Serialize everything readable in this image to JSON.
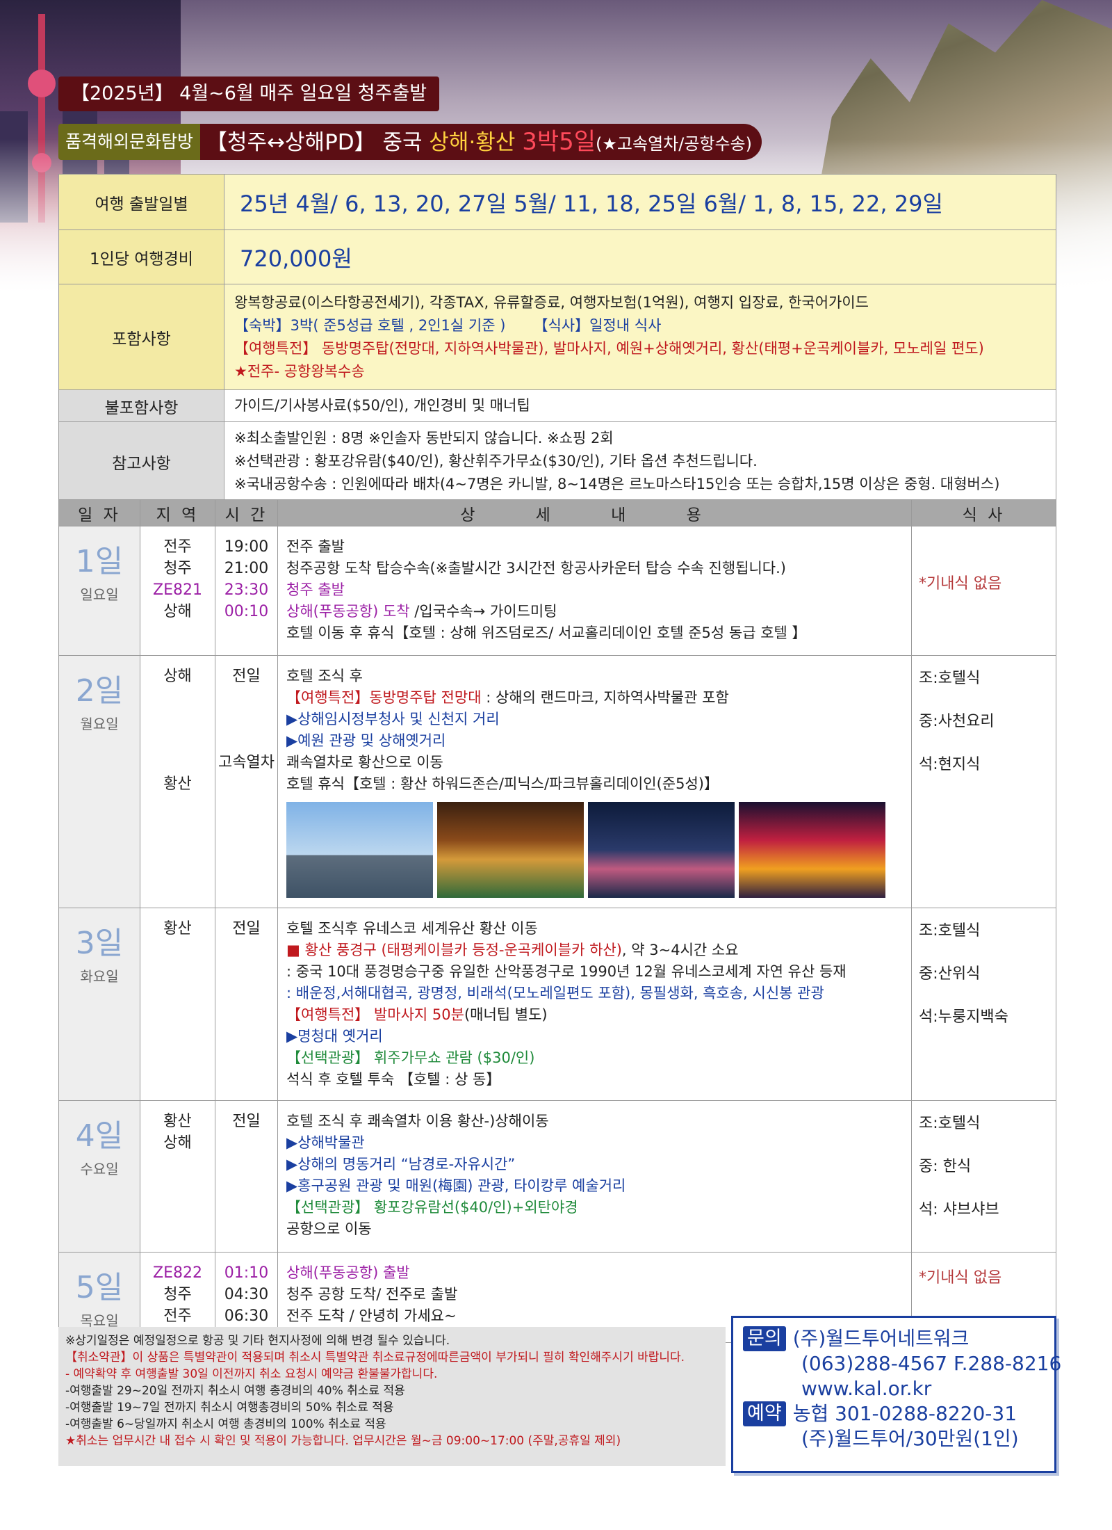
{
  "header": {
    "banner_top": "【2025년】 4월~6월 매주 일요일 청주출발",
    "tag": "품격해외문화탐방",
    "title_route": "【청주↔상해PD】",
    "title_country": "중국",
    "title_dest": "상해·황산",
    "title_days": "3박5일",
    "title_extra": "(★고속열차/공항수송)"
  },
  "info": {
    "departure_label": "여행 출발일별",
    "departure_value": "25년 4월/ 6, 13, 20, 27일 5월/ 11, 18, 25일 6월/ 1, 8, 15, 22, 29일",
    "price_label": "1인당 여행경비",
    "price_value": "720,000원",
    "included_label": "포함사항",
    "included_line1": "왕복항공료(이스타항공전세기), 각종TAX, 유류할증료, 여행자보험(1억원), 여행지 입장료, 한국어가이드",
    "included_line2a": "【숙박】3박( 준5성급 호텔 , 2인1실 기준 )",
    "included_line2b": "【식사】일정내 식사",
    "included_line3": "【여행특전】 동방명주탑(전망대, 지하역사박물관), 발마사지, 예원+상해옛거리, 황산(태평+운곡케이블카, 모노레일 편도)",
    "included_line4": "★전주- 공항왕복수송",
    "excluded_label": "불포함사항",
    "excluded_value": "가이드/기사봉사료($50/인), 개인경비 및 매너팁",
    "notes_label": "참고사항",
    "notes_line1": "※최소출발인원 : 8명 ※인솔자 동반되지 않습니다. ※쇼핑 2회",
    "notes_line2": "※선택관광 : 황포강유람($40/인), 황산휘주가무쇼($30/인), 기타 옵션 추천드립니다.",
    "notes_line3": "※국내공항수송 : 인원에따라 배차(4~7명은 카니발, 8~14명은 르노마스타15인승 또는 승합차,15명 이상은 중형. 대형버스)"
  },
  "itinerary": {
    "headers": [
      "일 자",
      "지 역",
      "시 간",
      "상 세 내 용",
      "식 사"
    ],
    "day1": {
      "num": "1일",
      "weekday": "일요일",
      "r1": "전주",
      "r2": "청주",
      "r3": "ZE821",
      "r4": "상해",
      "t1": "19:00",
      "t2": "21:00",
      "t3": "23:30",
      "t4": "00:10",
      "d1": "전주 출발",
      "d2": "청주공항 도착 탑승수속(※출발시간 3시간전 항공사카운터 탑승 수속 진행됩니다.)",
      "d3": "청주 출발",
      "d4a": "상해(푸동공항) 도착",
      "d4b": " /입국수속→ 가이드미팅",
      "d5": "호텔 이동 후 휴식【호텔 : 상해 위즈덤로즈/ 서교홀리데이인 호텔 준5성 동급 호텔 】",
      "meal": "*기내식 없음"
    },
    "day2": {
      "num": "2일",
      "weekday": "월요일",
      "r1": "상해",
      "r2": "황산",
      "t1": "전일",
      "t2": "고속열차",
      "d1": "호텔 조식 후",
      "d2a": "【여행특전】동방명주탑 전망대",
      "d2b": " : 상해의 랜드마크, 지하역사박물관 포함",
      "d3": "▶상해임시정부청사 및 신천지 거리",
      "d4": "▶예원 관광 및 상해옛거리",
      "d5": "쾌속열차로 황산으로 이동",
      "d6": "호텔 휴식【호텔 : 황산 하워드존슨/피닉스/파크뷰홀리데이인(준5성)】",
      "meal1": "조:호텔식",
      "meal2": "중:사천요리",
      "meal3": "석:현지식"
    },
    "day3": {
      "num": "3일",
      "weekday": "화요일",
      "r1": "황산",
      "t1": "전일",
      "d1": "호텔 조식후 유네스코 세계유산 황산 이동",
      "d2a": "■ 황산 풍경구 (태평케이블카 등정-운곡케이블카 하산)",
      "d2b": ", 약 3~4시간 소요",
      "d3": ": 중국 10대 풍경명승구중 유일한 산악풍경구로 1990년 12월 유네스코세계 자연 유산 등재",
      "d4": ": 배운정,서해대협곡, 광명정, 비래석(모노레일편도 포함), 몽필생화, 흑호송, 시신봉 관광",
      "d5a": "【여행특전】 발마사지 50분",
      "d5b": "(매너팁 별도)",
      "d6": "▶명청대 옛거리",
      "d7": "【선택관광】 휘주가무쇼 관람 ($30/인)",
      "d8": "석식 후 호텔 투숙 【호텔 : 상 동】",
      "meal1": "조:호텔식",
      "meal2": "중:산위식",
      "meal3": "석:누룽지백숙"
    },
    "day4": {
      "num": "4일",
      "weekday": "수요일",
      "r1": "황산",
      "r2": "상해",
      "t1": "전일",
      "d1": "호텔 조식 후 쾌속열차 이용 황산-)상해이동",
      "d2": "▶상해박물관",
      "d3": "▶상해의 명동거리 “남경로-자유시간”",
      "d4": "▶홍구공원 관광 및 매원(梅園) 관광, 타이캉루 예술거리",
      "d5": "【선택관광】 황포강유람선($40/인)+외탄야경",
      "d6": "공항으로 이동",
      "meal1": "조:호텔식",
      "meal2": "중: 한식",
      "meal3": "석: 샤브샤브"
    },
    "day5": {
      "num": "5일",
      "weekday": "목요일",
      "r1": "ZE822",
      "r2": "청주",
      "r3": "전주",
      "t1": "01:10",
      "t2": "04:30",
      "t3": "06:30",
      "d1": "상해(푸동공항) 출발",
      "d2": "청주 공항 도착/ 전주로 출발",
      "d3": "전주 도착 / 안녕히 가세요~",
      "meal": "*기내식 없음"
    }
  },
  "footer": {
    "n1": "※상기일정은 예정일정으로 항공 및 기타 현지사정에 의해 변경 될수 있습니다.",
    "n2": "【취소약관】이 상품은 특별약관이 적용되며 취소시 특별약관 취소료규정에따른금액이 부가되니 필히 확인해주시기 바랍니다.",
    "n3": "- 예약확약 후 여행출발 30일 이전까지 취소 요청시 예약금 환불불가합니다.",
    "n4": "-여행출발 29~20일 전까지 취소시 여행 총경비의 40% 취소료 적용",
    "n5": "-여행출발 19~7일 전까지 취소시 여행총경비의 50% 취소료 적용",
    "n6": "-여행출발 6~당일까지 취소시 여행 총경비의 100% 취소료 적용",
    "n7": "★취소는 업무시간 내 접수 시 확인 및 적용이 가능합니다. 업무시간은 월~금 09:00~17:00 (주말,공휴일 제외)"
  },
  "contact": {
    "inquiry_label": "문의",
    "company": "(주)월드투어네트워크",
    "phone": "(063)288-4567 F.288-8216",
    "web": "www.kal.or.kr",
    "booking_label": "예약",
    "bank": "농협 301-0288-8220-31",
    "holder": "(주)월드투어/30만원(1인)"
  }
}
